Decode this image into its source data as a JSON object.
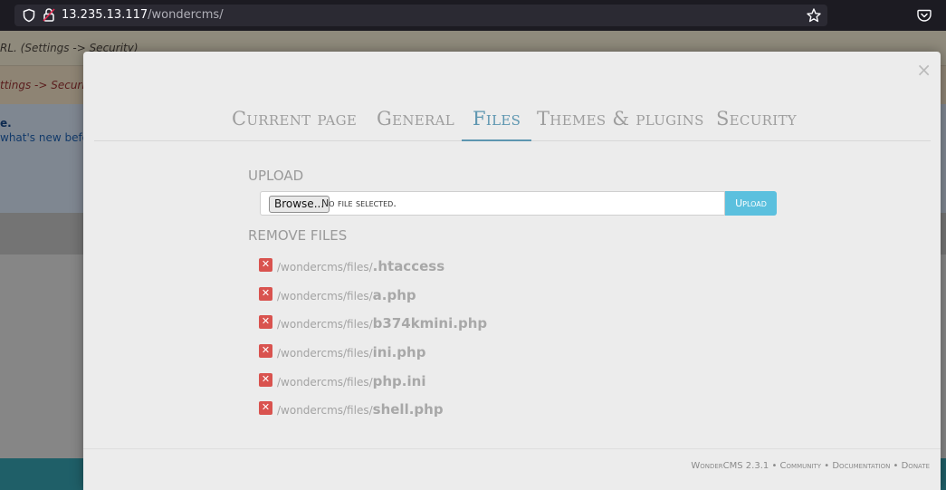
{
  "browser": {
    "url_host": "13.235.13.117",
    "url_path": "/wondercms/"
  },
  "background": {
    "row1_text": "RL. (Settings -> Security)",
    "row2_text": "ttings -> Security",
    "row3_bold": "e.",
    "row3_text": "what's new befor"
  },
  "modal": {
    "close_label": "×",
    "tabs": [
      {
        "label": "Current page"
      },
      {
        "label": "General"
      },
      {
        "label": "Files"
      },
      {
        "label": "Themes & plugins"
      },
      {
        "label": "Security"
      }
    ],
    "active_tab": "Files",
    "upload": {
      "section_label": "UPLOAD",
      "browse_label": "Browse...",
      "no_file_label": "No file selected.",
      "upload_button_label": "Upload"
    },
    "remove": {
      "section_label": "REMOVE FILES",
      "delete_icon_label": "✕",
      "files": [
        {
          "path": "/wondercms/files/",
          "name": ".htaccess"
        },
        {
          "path": "/wondercms/files/",
          "name": "a.php"
        },
        {
          "path": "/wondercms/files/",
          "name": "b374kmini.php"
        },
        {
          "path": "/wondercms/files/",
          "name": "ini.php"
        },
        {
          "path": "/wondercms/files/",
          "name": "php.ini"
        },
        {
          "path": "/wondercms/files/",
          "name": "shell.php"
        }
      ]
    },
    "footer": {
      "version": "WonderCMS 2.3.1",
      "sep": " • ",
      "links": [
        "Community",
        "Documentation",
        "Donate"
      ]
    }
  },
  "colors": {
    "accent": "#5d96b0",
    "upload_button": "#5bc0de",
    "delete_button": "#d9534f"
  }
}
